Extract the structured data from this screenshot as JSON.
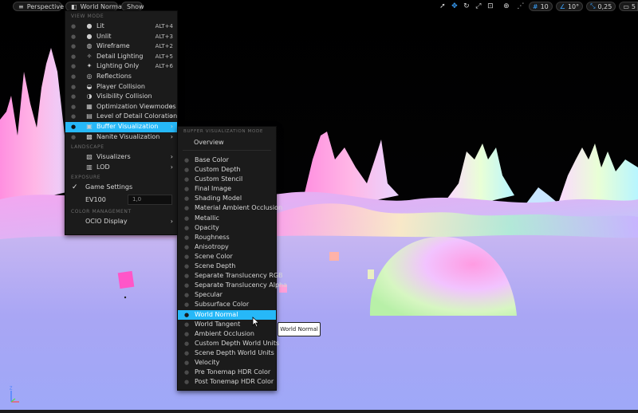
{
  "toolbar": {
    "left": {
      "menu_icon": "hamburger-icon",
      "perspective_label": "Perspective",
      "view_mode_label": "World Normal",
      "show_label": "Show"
    },
    "right": {
      "grid_value": "10",
      "angle_value": "10°",
      "scale_value": "0,25",
      "camera_speed_value": "5"
    }
  },
  "view_mode_menu": {
    "sections": {
      "view_mode": "VIEW MODE",
      "landscape": "LANDSCAPE",
      "exposure": "EXPOSURE",
      "color_management": "COLOR MANAGEMENT"
    },
    "items": [
      {
        "label": "Lit",
        "shortcut": "ALT+4",
        "icon": "sphere-icon"
      },
      {
        "label": "Unlit",
        "shortcut": "ALT+3",
        "icon": "sphere-icon"
      },
      {
        "label": "Wireframe",
        "shortcut": "ALT+2",
        "icon": "wireframe-sphere-icon"
      },
      {
        "label": "Detail Lighting",
        "shortcut": "ALT+5",
        "icon": "detail-lighting-icon"
      },
      {
        "label": "Lighting Only",
        "shortcut": "ALT+6",
        "icon": "bulb-icon"
      },
      {
        "label": "Reflections",
        "shortcut": "",
        "icon": "reflection-icon"
      },
      {
        "label": "Player Collision",
        "shortcut": "",
        "icon": "collision-icon"
      },
      {
        "label": "Visibility Collision",
        "shortcut": "",
        "icon": "visibility-collision-icon"
      },
      {
        "label": "Optimization Viewmodes",
        "shortcut": "",
        "icon": "optimization-icon",
        "submenu": true
      },
      {
        "label": "Level of Detail Coloration",
        "shortcut": "",
        "icon": "lod-coloration-icon",
        "submenu": true
      },
      {
        "label": "Buffer Visualization",
        "shortcut": "",
        "icon": "buffer-icon",
        "submenu": true,
        "selected": true
      },
      {
        "label": "Nanite Visualization",
        "shortcut": "",
        "icon": "nanite-icon",
        "submenu": true
      }
    ],
    "landscape_items": [
      {
        "label": "Visualizers",
        "icon": "visualizers-icon",
        "submenu": true
      },
      {
        "label": "LOD",
        "icon": "lod-icon",
        "submenu": true
      }
    ],
    "exposure": {
      "game_settings_label": "Game Settings",
      "ev_label": "EV100",
      "ev_value": "1,0"
    },
    "color_management": {
      "ocio_label": "OCIO Display"
    }
  },
  "buffer_menu": {
    "section": "BUFFER VISUALIZATION MODE",
    "overview": "Overview",
    "items": [
      "Base Color",
      "Custom Depth",
      "Custom Stencil",
      "Final Image",
      "Shading Model",
      "Material Ambient Occlusion",
      "Metallic",
      "Opacity",
      "Roughness",
      "Anisotropy",
      "Scene Color",
      "Scene Depth",
      "Separate Translucency RGB",
      "Separate Translucency Alpha",
      "Specular",
      "Subsurface Color",
      "World Normal",
      "World Tangent",
      "Ambient Occlusion",
      "Custom Depth World Units",
      "Scene Depth World Units",
      "Velocity",
      "Pre Tonemap HDR Color",
      "Post Tonemap HDR Color"
    ],
    "selected": "World Normal"
  },
  "tooltip": {
    "text": "World Normal"
  },
  "gizmo": {
    "z_label": "Z"
  },
  "colors": {
    "accent": "#26b8f8",
    "menu_bg": "#1b1b1b"
  }
}
